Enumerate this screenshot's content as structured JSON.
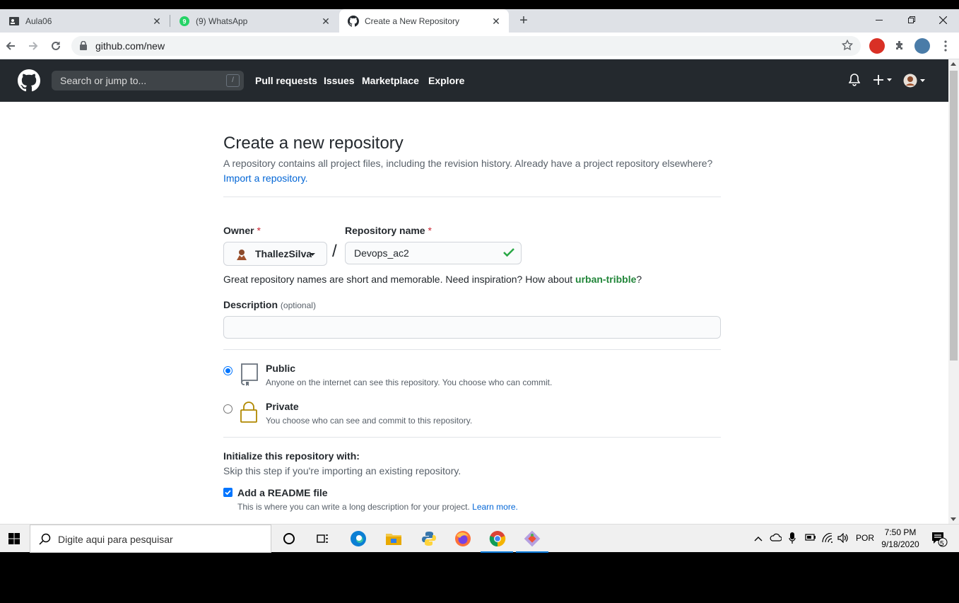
{
  "browser": {
    "tabs": [
      {
        "title": "Aula06",
        "icon": "contact-card-icon"
      },
      {
        "title": "(9) WhatsApp",
        "icon": "whatsapp-icon",
        "badge": "9"
      },
      {
        "title": "Create a New Repository",
        "icon": "github-icon",
        "active": true
      }
    ],
    "url": "github.com/new"
  },
  "header": {
    "search_placeholder": "Search or jump to...",
    "search_shortcut": "/",
    "nav": [
      "Pull requests",
      "Issues",
      "Marketplace",
      "Explore"
    ]
  },
  "page": {
    "title": "Create a new repository",
    "subtitle": "A repository contains all project files, including the revision history. Already have a project repository elsewhere?",
    "import_link": "Import a repository.",
    "owner_label": "Owner",
    "owner_value": "ThallezSilva",
    "repo_label": "Repository name",
    "required_mark": "*",
    "slash": "/",
    "repo_value": "Devops_ac2",
    "hint_prefix": "Great repository names are short and memorable. Need inspiration? How about ",
    "hint_suggestion": "urban-tribble",
    "hint_suffix": "?",
    "description_label": "Description",
    "description_optional": "(optional)",
    "description_value": "",
    "visibility": [
      {
        "title": "Public",
        "desc": "Anyone on the internet can see this repository. You choose who can commit.",
        "selected": true
      },
      {
        "title": "Private",
        "desc": "You choose who can see and commit to this repository.",
        "selected": false
      }
    ],
    "init_title": "Initialize this repository with:",
    "init_sub": "Skip this step if you're importing an existing repository.",
    "readme_label": "Add a README file",
    "readme_checked": true,
    "readme_desc": "This is where you can write a long description for your project. ",
    "readme_link": "Learn more."
  },
  "taskbar": {
    "search_placeholder": "Digite aqui para pesquisar",
    "language": "POR",
    "time": "7:50 PM",
    "date": "9/18/2020",
    "notifications": "5"
  },
  "colors": {
    "gh_header": "#24292e",
    "link": "#0366d6",
    "success": "#28a745",
    "suggestion": "#22863a"
  }
}
